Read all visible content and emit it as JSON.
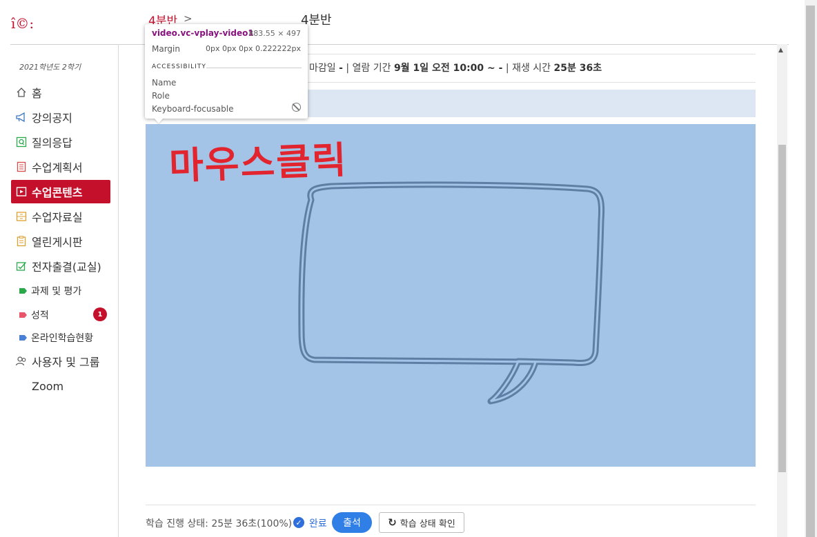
{
  "header": {
    "logo_text": "î©:",
    "breadcrumb_link": "4분반",
    "breadcrumb_sep": ">",
    "page_title": "4분반"
  },
  "sidebar": {
    "semester": "2021학년도 2학기",
    "items": [
      {
        "label": "홈",
        "icon": "home-icon"
      },
      {
        "label": "강의공지",
        "icon": "megaphone-icon"
      },
      {
        "label": "질의응답",
        "icon": "qa-icon"
      },
      {
        "label": "수업계획서",
        "icon": "document-icon"
      },
      {
        "label": "수업콘텐츠",
        "icon": "play-icon",
        "active": true
      },
      {
        "label": "수업자료실",
        "icon": "archive-icon"
      },
      {
        "label": "열린게시판",
        "icon": "board-icon"
      },
      {
        "label": "전자출결(교실)",
        "icon": "attendance-icon"
      }
    ],
    "sub_items": [
      {
        "label": "과제 및 평가",
        "color": "#2aa84a"
      },
      {
        "label": "성적",
        "color": "#e8556b",
        "badge": "1"
      },
      {
        "label": "온라인학습현황",
        "color": "#4a7fd6"
      }
    ],
    "users_label": "사용자 및 그룹",
    "zoom_label": "Zoom"
  },
  "content": {
    "deadline_label": "마감일",
    "deadline_value": "-",
    "open_label": "열람 기간",
    "open_value": "9월 1일 오전 10:00 ~ -",
    "play_label": "재생 시간",
    "play_value": "25분 36초",
    "video_overlay_text": "마우스클릭"
  },
  "tooltip": {
    "selector": "video.vc-vplay-video1",
    "dimensions": "883.55 × 497",
    "margin_label": "Margin",
    "margin_value": "0px 0px 0px 0.222222px",
    "accessibility_label": "ACCESSIBILITY",
    "name_label": "Name",
    "role_label": "Role",
    "keyboard_label": "Keyboard-focusable"
  },
  "footer": {
    "status_text": "학습 진행 상태: 25분 36초(100%)",
    "done_label": "완료",
    "attend_label": "출석",
    "check_label": "학습 상태 확인"
  },
  "colors": {
    "brand": "#c4102b",
    "video_bg": "#a3c4e6",
    "accent_blue": "#2f7fe6"
  }
}
